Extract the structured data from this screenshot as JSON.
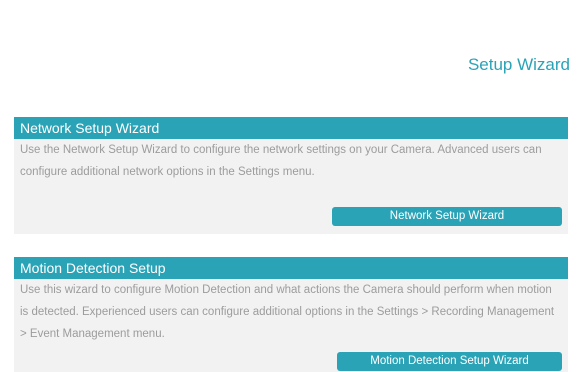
{
  "page": {
    "title": "Setup Wizard"
  },
  "sections": {
    "network": {
      "header": "Network Setup Wizard",
      "description": "Use the Network Setup Wizard to configure the network settings on your Camera. Advanced users can configure additional network options in the Settings menu.",
      "button_label": "Network Setup Wizard"
    },
    "motion": {
      "header": "Motion Detection Setup",
      "description": "Use this wizard to configure Motion Detection and what actions the Camera should perform when motion is detected. Experienced users can configure additional options in the Settings > Recording Management > Event Management menu.",
      "button_label": "Motion Detection Setup Wizard"
    }
  },
  "colors": {
    "accent": "#2aa3b7",
    "panel_background": "#f2f2f2",
    "body_text": "#9c9c9c"
  }
}
